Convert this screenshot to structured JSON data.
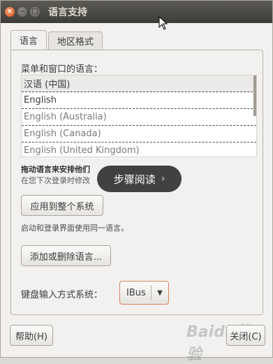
{
  "window": {
    "title": "语言支持",
    "controls": {
      "close": "×",
      "minimize": "−",
      "maximize": "□"
    }
  },
  "tabs": [
    {
      "label": "语言",
      "active": true
    },
    {
      "label": "地区格式",
      "active": false
    }
  ],
  "language_section": {
    "label": "菜单和窗口的语言：",
    "items": [
      {
        "label": "汉语 (中国)",
        "state": "active"
      },
      {
        "label": "English",
        "state": "active"
      },
      {
        "label": "English (Australia)",
        "state": "inactive"
      },
      {
        "label": "English (Canada)",
        "state": "inactive"
      },
      {
        "label": "English (United Kingdom)",
        "state": "inactive"
      }
    ],
    "hint_bold": "拖动语言来安排他们",
    "hint_normal": "在您下次登录时修改"
  },
  "overlay": {
    "label": "步骤阅读",
    "chevron": "›"
  },
  "buttons": {
    "apply": "应用到整个系统",
    "note": "启动和登录界面使用同一语言。",
    "add_remove": "添加或删除语言...",
    "help": "帮助(H)",
    "close": "关闭(C)"
  },
  "keyboard": {
    "label": "键盘输入方式系统：",
    "value": "IBus",
    "arrow": "▼"
  },
  "watermark": "Baidu经验",
  "colors": {
    "titlebar": "#3d3c38",
    "accent": "#e0541a",
    "focus_border": "#d6855f"
  }
}
